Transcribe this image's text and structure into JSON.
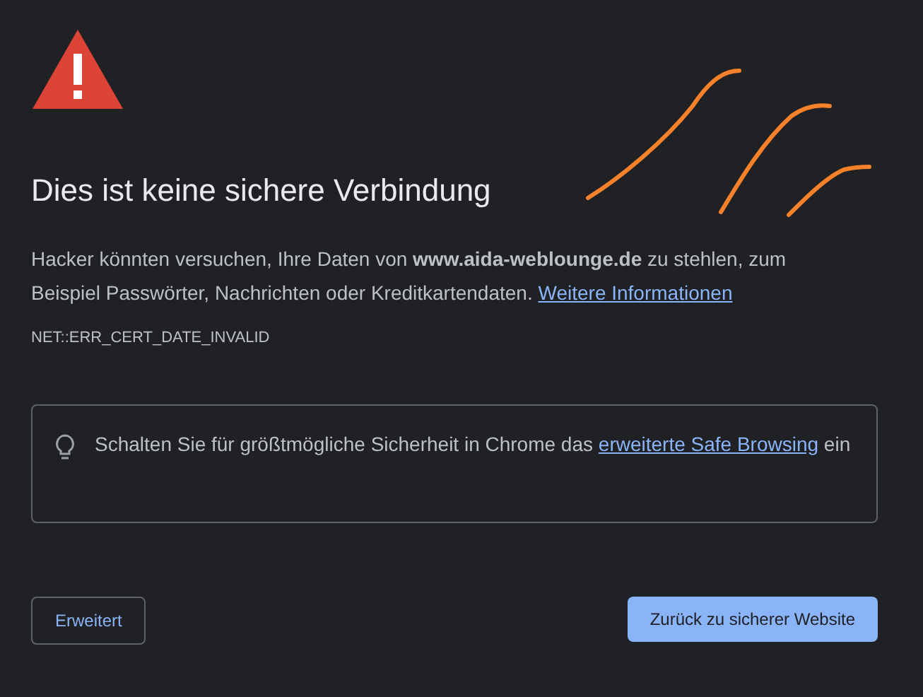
{
  "title": "Dies ist keine sichere Verbindung",
  "message": {
    "text": "Hacker könnten versuchen, Ihre Daten von **www.aida-weblounge.de** zu stehlen, zum Beispiel Passwörter, Nachrichten oder Kreditkartendaten.",
    "link": "Weitere Informationen"
  },
  "error_code": "NET::ERR_CERT_DATE_INVALID",
  "tip": {
    "text_before": "Schalten Sie für größtmögliche Sicherheit in Chrome das",
    "link": "erweiterte Safe Browsing",
    "text_after": "ein"
  },
  "buttons": [
    {
      "label": "Erweitert",
      "kind": "secondary"
    },
    {
      "label": "Zurück zu sicherer Website",
      "kind": "primary"
    }
  ]
}
